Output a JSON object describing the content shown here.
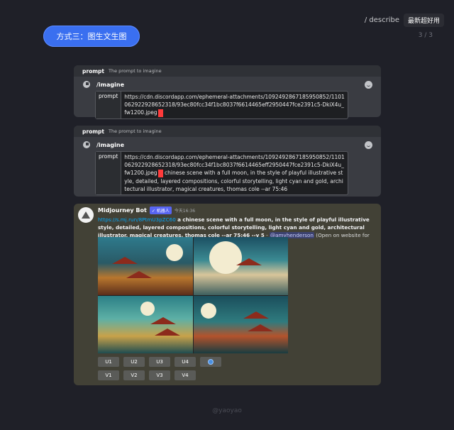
{
  "top": {
    "command": "/ describe",
    "tag": "最新超好用",
    "page": "3 / 3"
  },
  "pill_label": "方式三：图生文生图",
  "panel1": {
    "hint_title": "prompt",
    "hint_desc": "The prompt to imagine",
    "command": "/imagine",
    "field_label": "prompt",
    "field_value": "https://cdn.discordapp.com/ephemeral-attachments/1092492867185950852/1101062922928652318/93ec80fcc34f1bc8037f6614465eff2950447fce2391c5-DkiX4u_fw1200.jpeg"
  },
  "panel2": {
    "hint_title": "prompt",
    "hint_desc": "The prompt to imagine",
    "command": "/imagine",
    "field_label": "prompt",
    "field_value_url": "https://cdn.discordapp.com/ephemeral-attachments/1092492867185950852/1101062922928652318/93ec80fcc34f1bc8037f6614465eff2950447fce2391c5-DkiX4u_fw1200.jpeg",
    "field_value_text": "chinese scene with a full moon, in the style of playful illustrative style, detailed, layered compositions, colorful storytelling, light cyan and gold, architectural illustrator, magical creatures, thomas cole --ar 75:46"
  },
  "bot": {
    "name": "Midjourney Bot",
    "badge": "✓ 机器人",
    "time": "今天16:36",
    "link": "https://s.mj.run/8PtmU3pZC60",
    "prompt": "a chinese scene with a full moon, in the style of playful illustrative style, detailed, layered compositions, colorful storytelling, light cyan and gold, architectural illustrator, magical creatures, thomas cole --ar 75:46 --v 5",
    "dash": " - ",
    "mention": "@amyhenderson",
    "suffix": " (Open on website for full quality) (relaxed)",
    "upscale_buttons": [
      "U1",
      "U2",
      "U3",
      "U4"
    ],
    "variation_buttons": [
      "V1",
      "V2",
      "V3",
      "V4"
    ],
    "refresh_icon": "refresh-icon"
  },
  "footer": "@yaoyao"
}
